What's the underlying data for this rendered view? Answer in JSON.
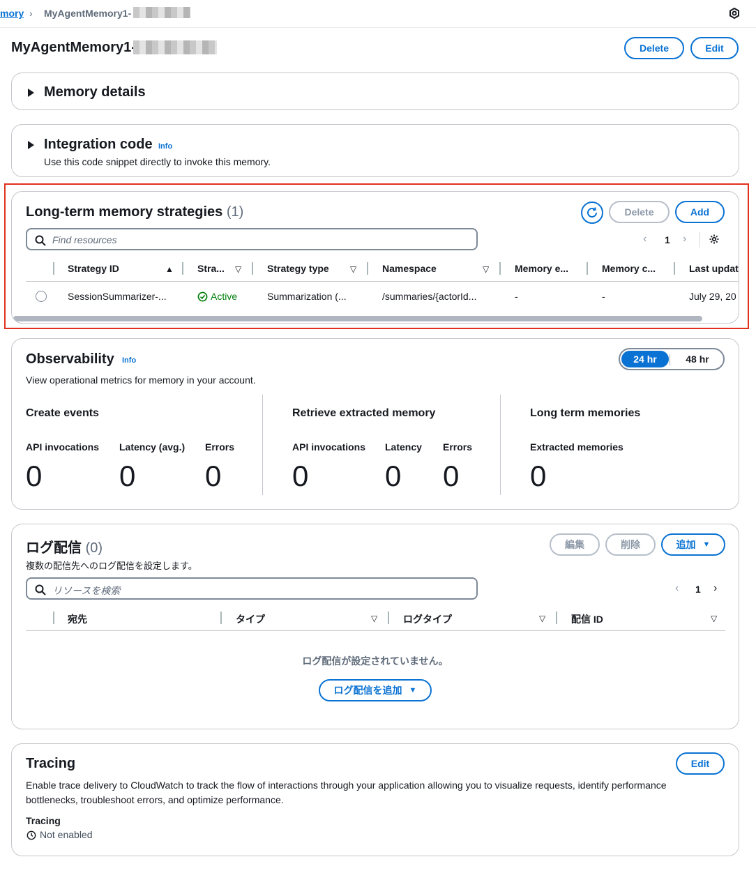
{
  "breadcrumb": {
    "parent": "mory",
    "current": "MyAgentMemory1-"
  },
  "page": {
    "title": "MyAgentMemory1-",
    "delete_label": "Delete",
    "edit_label": "Edit"
  },
  "memory_details": {
    "title": "Memory details"
  },
  "integration": {
    "title": "Integration code",
    "info": "Info",
    "description": "Use this code snippet directly to invoke this memory."
  },
  "strategies": {
    "title": "Long-term memory strategies",
    "count": "(1)",
    "delete_label": "Delete",
    "add_label": "Add",
    "search_placeholder": "Find resources",
    "page": "1",
    "columns": [
      "Strategy ID",
      "Stra...",
      "Strategy type",
      "Namespace",
      "Memory e...",
      "Memory c...",
      "Last update"
    ],
    "rows": [
      {
        "id": "SessionSummarizer-...",
        "status": "Active",
        "type": "Summarization (...",
        "namespace": "/summaries/{actorId...",
        "memory_e": "-",
        "memory_c": "-",
        "updated": "July 29, 20"
      }
    ],
    "scroll_fraction": 0.95
  },
  "observability": {
    "title": "Observability",
    "info": "Info",
    "description": "View operational metrics for memory in your account.",
    "range_24": "24 hr",
    "range_48": "48 hr",
    "groups": [
      {
        "title": "Create events",
        "metrics": [
          {
            "label": "API invocations",
            "value": "0"
          },
          {
            "label": "Latency (avg.)",
            "value": "0"
          },
          {
            "label": "Errors",
            "value": "0"
          }
        ]
      },
      {
        "title": "Retrieve extracted memory",
        "metrics": [
          {
            "label": "API invocations",
            "value": "0"
          },
          {
            "label": "Latency",
            "value": "0"
          },
          {
            "label": "Errors",
            "value": "0"
          }
        ]
      },
      {
        "title": "Long term memories",
        "metrics": [
          {
            "label": "Extracted memories",
            "value": "0"
          }
        ]
      }
    ]
  },
  "log_delivery": {
    "title": "ログ配信",
    "count": "(0)",
    "description": "複数の配信先へのログ配信を設定します。",
    "edit_label": "編集",
    "delete_label": "削除",
    "add_label": "追加",
    "search_placeholder": "リソースを検索",
    "page": "1",
    "columns": [
      "宛先",
      "タイプ",
      "ログタイプ",
      "配信 ID"
    ],
    "empty_text": "ログ配信が設定されていません。",
    "empty_add_label": "ログ配信を追加"
  },
  "tracing": {
    "title": "Tracing",
    "edit_label": "Edit",
    "description": "Enable trace delivery to CloudWatch to track the flow of interactions through your application allowing you to visualize requests, identify performance bottlenecks, troubleshoot errors, and optimize performance.",
    "field_label": "Tracing",
    "field_value": "Not enabled"
  },
  "colors": {
    "accent": "#0972d3",
    "success": "#037f0c",
    "highlight": "#e0311f"
  }
}
